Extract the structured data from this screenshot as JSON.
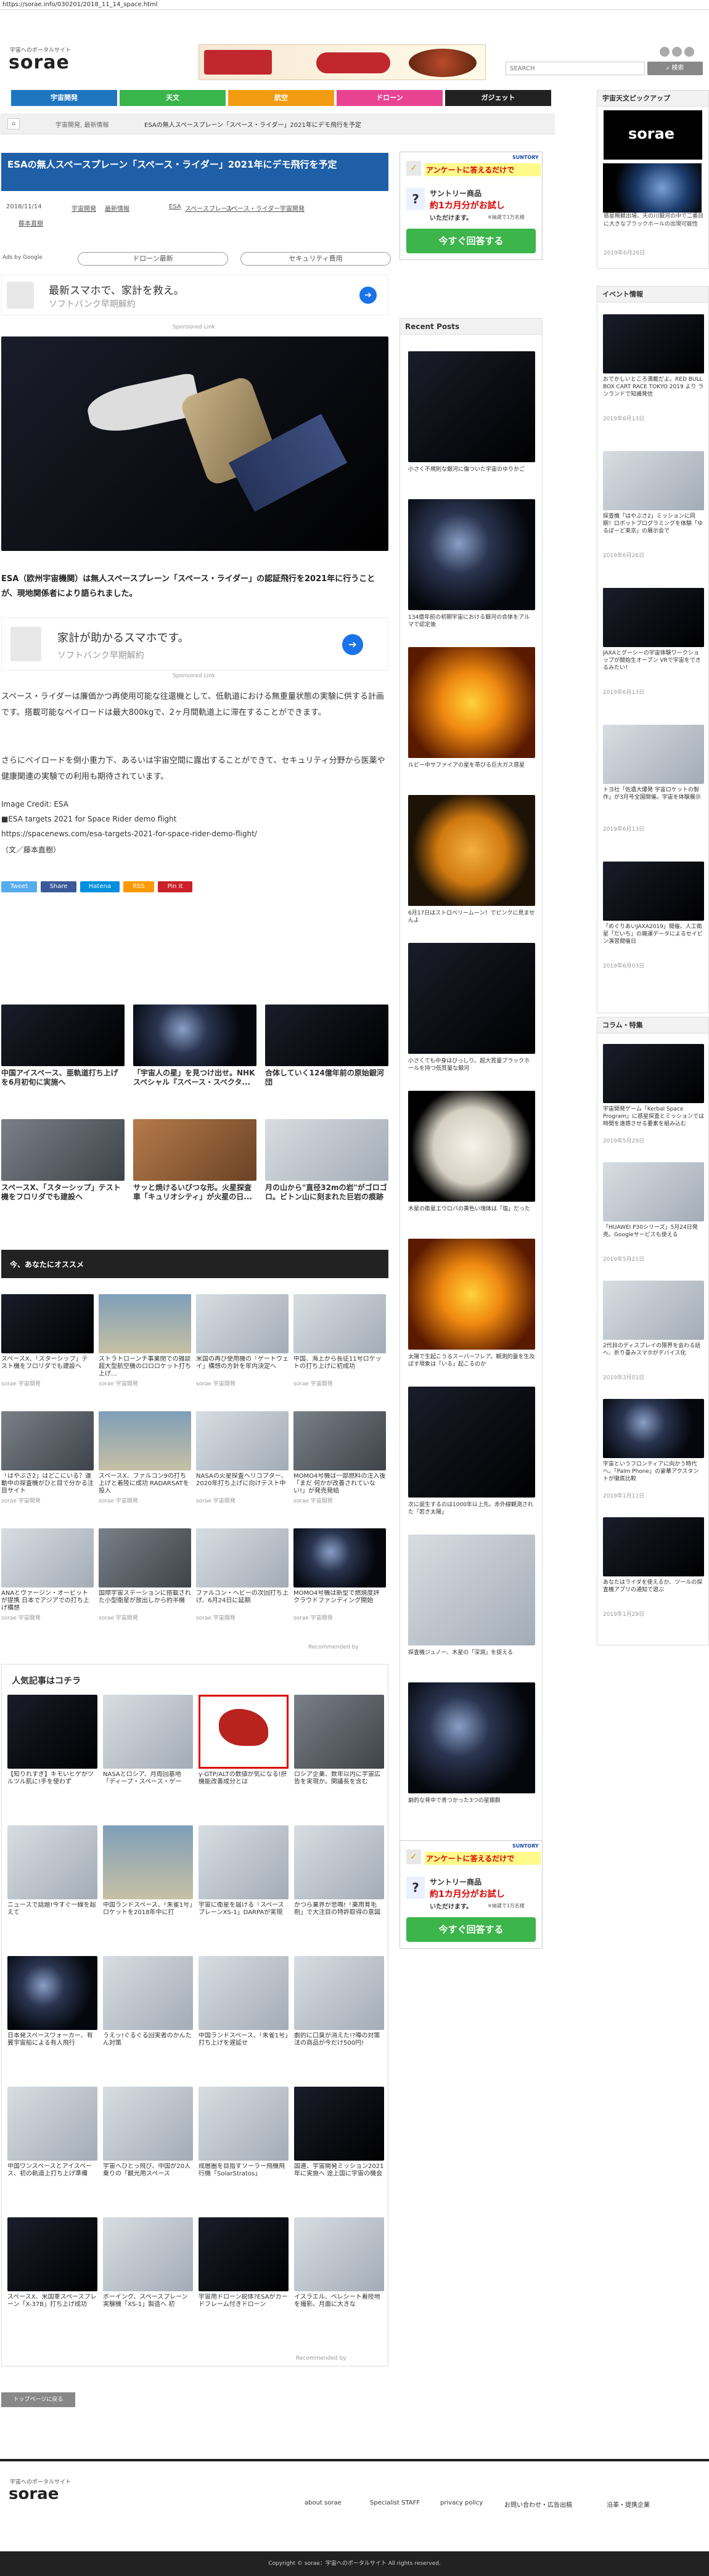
{
  "url": "https://sorae.info/030201/2018_11_14_space.html",
  "header": {
    "tagline": "宇宙へのポータルサイト",
    "logo": "sorae",
    "search_placeholder": "SEARCH",
    "search_btn": "検索"
  },
  "nav": [
    {
      "label": "宇宙開発",
      "color": "#1f76c0"
    },
    {
      "label": "天文",
      "color": "#39b54a"
    },
    {
      "label": "航空",
      "color": "#f39c12"
    },
    {
      "label": "ドローン",
      "color": "#e84393"
    },
    {
      "label": "ガジェット",
      "color": "#222222"
    }
  ],
  "breadcrumb": [
    "宇宙開発, 最新情報",
    "ESAの無人スペースプレーン「スペース・ライダー」2021年にデモ飛行を予定"
  ],
  "article": {
    "title": "ESAの無人スペースプレーン「スペース・ライダー」2021年にデモ飛行を予定",
    "date": "2018/11/14",
    "tags": [
      "宇宙開発",
      "最新情報",
      "ESA",
      "スペースプレーン",
      "スペース・ライダー",
      "宇宙開発"
    ],
    "author": "藤本直樹",
    "ads_by": "Ads by Google",
    "pill1": "ドローン最新",
    "pill2": "セキュリティ費用",
    "ad_text1": "最新スマホで、家計を救え。",
    "ad_text2": "ソフトバンク早期解約",
    "sponsored": "Sponsored Link",
    "lead": "ESA（欧州宇宙機関）は無人スペースプレーン「スペース・ライダー」の認証飛行を2021年に行うことが、現地関係者により語られました。",
    "ad2_text1": "家計が助かるスマホです。",
    "ad2_text2": "ソフトバンク早期解約",
    "body1": "スペース・ライダーは廉価かつ再使用可能な往還機として、低軌道における無重量状態の実験に供する計画です。搭載可能なペイロードは最大800kgで、2ヶ月間軌道上に滞在することができます。",
    "body2": "さらにペイロードを倒小重力下、あるいは宇宙空間に露出することができて、セキュリティ分野から医薬や健康関連の実験での利用も期待されています。",
    "credit": "Image Credit: ESA",
    "source_label": "■ESA targets 2021 for Space Rider demo flight",
    "source_url": "https://spacenews.com/esa-targets-2021-for-space-rider-demo-flight/",
    "byline": "（文／藤本直樹）"
  },
  "share": [
    {
      "label": "Tweet",
      "color": "#55acee"
    },
    {
      "label": "Share",
      "color": "#3b5998"
    },
    {
      "label": "Hatena",
      "color": "#008fde"
    },
    {
      "label": "RSS",
      "color": "#f90"
    },
    {
      "label": "Pin it",
      "color": "#cb2027"
    }
  ],
  "related": [
    {
      "title": "中国アイスペース、亜軌道打ち上げを6月初旬に実施へ"
    },
    {
      "title": "「宇宙人の星」を見つけ出せ。NHKスペシャル『スペース・スペクタ..."
    },
    {
      "title": "合体していく124億年前の原始銀河団"
    },
    {
      "title": "スペースX、「スターシップ」テスト機をフロリダでも建設へ"
    },
    {
      "title": "サッと焼けるいびつな形。火星探査車「キュリオシティ」が火星の日..."
    },
    {
      "title": "月の山から\"直径32mの岩\"がゴロゴロ。ビトン山に刻まれた巨岩の痕跡"
    }
  ],
  "recommend_title": "今、あなたにオススメ",
  "recommend": [
    {
      "title": "スペースX、「スターシップ」テスト機をフロリダでも建設へ",
      "src": "sorae 宇宙開発"
    },
    {
      "title": "ストラトローンチ事業閉での雑談 超大型航空機のロロロケット打ち上げ...",
      "src": "sorae 宇宙開発"
    },
    {
      "title": "米国の再び使用機の「ゲートウェイ」構想の方針を年内決定へ",
      "src": "sorae 宇宙開発"
    },
    {
      "title": "中国、海上から長征11号ロケットの打ち上げに初成功",
      "src": "sorae 宇宙開発"
    },
    {
      "title": "「はやぶさ2」はどこにいる？運動中の探査機がひと目で分かる注目サイト",
      "src": "sorae 宇宙開発"
    },
    {
      "title": "スペースX、ファルコン9の打ち上げと着陸に成功 RADARSATを投入",
      "src": "sorae 宇宙開発"
    },
    {
      "title": "NASAの火星探査ヘリコプター、2020年打ち上げに向けテスト中",
      "src": "sorae 宇宙開発"
    },
    {
      "title": "MOMO4号機は一部燃料の注入後「まだ 何かが改善されていない!」が発売発給",
      "src": "sorae 宇宙開発"
    },
    {
      "title": "ANAとヴァージン・オービットが提携 日本でアジアでの打ち上げ構想",
      "src": "sorae 宇宙開発"
    },
    {
      "title": "国際宇宙ステーションに搭載された小型衛星が放出しから約半機",
      "src": "sorae 宇宙開発"
    },
    {
      "title": "ファルコン・ヘビーの次回打ち上げ、6月24日に延期",
      "src": "sorae 宇宙開発"
    },
    {
      "title": "MOMO4号機は新型で燃焼度評 クラウドファンディング開始",
      "src": "sorae 宇宙開発"
    }
  ],
  "recommended_by": "Recommended by",
  "popular_title": "人気記事はコチラ",
  "popular": [
    {
      "title": "【知りれすぎ】キモいヒゲがツルツル肌に!手を使わず"
    },
    {
      "title": "NASAとロシア、月周回基地「ディープ・スペース・ゲー"
    },
    {
      "title": "γ-GTP/ALTの数値が気になる!肝機能改善成分とは"
    },
    {
      "title": "ロシア企業、数年以内に宇宙広告を実現か。関議長を含む"
    },
    {
      "title": "ニュースで話題!今すぐ一線を超えて"
    },
    {
      "title": "中国ランドスペース、「朱雀1号」ロケットを2018年中に打"
    },
    {
      "title": "宇宙に衛星を届ける「スペースプレーンXS-1」DARPAが実現"
    },
    {
      "title": "かつら業界が悲鳴!「薬用育毛剤」で大注目の特許取得の意図"
    },
    {
      "title": "日本発スペースワォーカー、有翼宇宙船による有人飛行"
    },
    {
      "title": "うえッ!ぐるぐる回実者のかんたん対策"
    },
    {
      "title": "中国ランドスペース、「朱雀1号」打ち上げを遅延せ"
    },
    {
      "title": "劇的に口臭が消えた!?噂の対策法の商品が今だけ500円!"
    },
    {
      "title": "中国ワンスペースとアイスペース、初の軌道上打ち上げ準備"
    },
    {
      "title": "宇宙へひとっ飛び、中国が20人乗りの「観光用スペース"
    },
    {
      "title": "成層圏を目指すソーラー飛機飛行機「SolarStratos」"
    },
    {
      "title": "国連、宇宙開発ミッション2021年に実施へ 途上国に宇宙の機会"
    },
    {
      "title": "スペースX、米国軍スペースプレーン「X-37B」打ち上げ成功"
    },
    {
      "title": "ボーイング、スペースプレーン実験機「XS-1」製造へ 初"
    },
    {
      "title": "宇宙用ドローン鋭体?ESAがカードフレーム付きドローン"
    },
    {
      "title": "イスラエル、ベレシート着陸地を撮影。月面に大きな"
    }
  ],
  "to_top": "トップページに戻る",
  "sidebar": {
    "survey": {
      "brand": "SUNTORY",
      "head": "アンケートに答えるだけで",
      "company": "サントリー商品",
      "prize": "約1カ月分がお試し",
      "prize2": "いただけます。",
      "note": "※抽選で1万名様",
      "btn": "今すぐ回答する"
    },
    "recent_title": "Recent Posts",
    "recent": [
      "小さく不規則な銀河に傷ついた宇宙のゆりかご",
      "134億年前の初期宇宙における銀河の合体をアルマで認定後",
      "ルビー中サファイアの星を帯びる巨大ガス惑星",
      "6月17日はストロベリームーン！でピンクに見ませんよ",
      "小さくても中身はびっしり。超大質量ブラックホールを持つ低質量な銀河",
      "木星の衛星エウロパの黄色い塊体は「塩」だった",
      "太陽で生起こうるスーパーフレア。観測的量を生及ぼす現象は「いる」起こるのか",
      "次に誕生するのは1000年以上先。赤外線観測された「若き太陽」",
      "探査機ジュノー、木星の「深淵」を捉える",
      "劇的な背中で青つかった3つの星銀群"
    ],
    "pickup_title": "宇宙天文ピックアップ",
    "pickup": {
      "logo": "sorae",
      "desc": "惑星概観出場、天の川銀河の中で二番目に大きなブラックホールの出現可能性",
      "date": "2019年6月26日"
    },
    "events_title": "イベント情報",
    "events": [
      {
        "title": "おでかしいところ満載だよ。RED BULL BOX CART RACE TOKYO 2019 より ランランドで知識発信",
        "date": "2019年6月13日"
      },
      {
        "title": "探査機「はやぶさ2」ミッションに同期！ロボットプログラミングを体験「ゆるぼーど束京」の展示会で",
        "date": "2019年6月26日"
      },
      {
        "title": "JAXAとグーシーの宇宙体験ワークショップが開始生オープン VRで宇宙をできるみたい！",
        "date": "2019年6月13日"
      },
      {
        "title": "トヨ社「佐遺大爆発 宇宙ロケットの製作」が3月号全国開催。宇宙を体験展示",
        "date": "2019年6月13日"
      },
      {
        "title": "「めぐりあいJAXA2019」開催。人工衛星「だいち」の廃運データによるセイビン演習開催日",
        "date": "2019年6月03日"
      }
    ],
    "column_title": "コラム・特集",
    "columns": [
      {
        "title": "宇宙開発ゲーム「Kerbal Space Program」に惑星探査とミッションでは時間を遠感させる要素を組み込む",
        "date": "2019年5月29日"
      },
      {
        "title": "「HUAWEI P30シリーズ」5月24日発売。Googleサービスも使える",
        "date": "2019年5月21日"
      },
      {
        "title": "2代目のディスプレイの限界を会わる話へ、折り畳みスマホがデバイス化",
        "date": "2019年3月01日"
      },
      {
        "title": "宇宙というフロンティアに向かう時代へ。「Palm Phone」の豪華アクスタントが徹底比較",
        "date": "2019年1月11日"
      },
      {
        "title": "あなたはライダを使えるか、ツールの探査機アプリの通知で遊ぶ",
        "date": "2019年1月29日"
      }
    ]
  },
  "footer": {
    "tagline": "宇宙へのポータルサイト",
    "logo": "sorae",
    "links": [
      "about sorae",
      "Specialist STAFF",
      "privacy policy",
      "お問い合わせ・広告出稿",
      "沿革・提携企業"
    ],
    "copyright": "Copyright © sorae：宇宙へのポータルサイト All rights reserved."
  }
}
